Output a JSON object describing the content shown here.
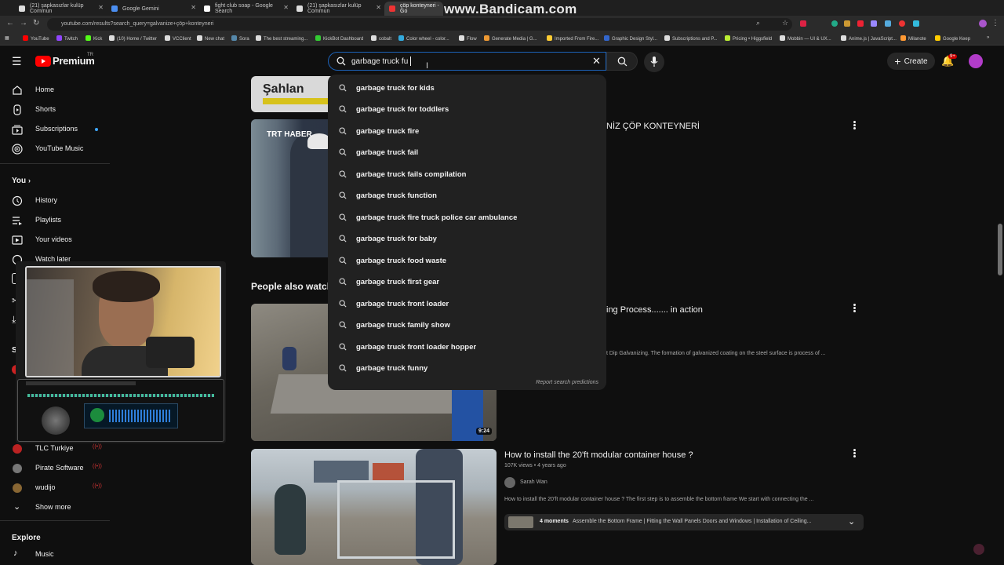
{
  "browser": {
    "tabs": [
      {
        "label": "(21) şapkasızlar kulüp Commun",
        "color": "#cccccc"
      },
      {
        "label": "Google Gemini",
        "color": "#4b8ef0"
      },
      {
        "label": "fight club soap - Google Search",
        "color": "#ffffff"
      },
      {
        "label": "(21) şapkasızlar kulüp Commun",
        "color": "#cccccc"
      },
      {
        "label": "çöp konteyneri - Go",
        "color": "#e33"
      }
    ],
    "watermark": "www.Bandicam.com",
    "url": "youtube.com/results?search_query=galvanize+çöp+konteyneri",
    "bookmarks": [
      "YouTube",
      "Twitch",
      "Kick",
      "(10) Home / Twitter",
      "VCClient",
      "New chat",
      "Sora",
      "The best streaming...",
      "KickBot Dashboard",
      "cobalt",
      "Color wheel - color...",
      "Flow",
      "Generate Media | G...",
      "Imported From Fire...",
      "Graphic Design Styl...",
      "Subscriptions and P...",
      "Pricing • Higgsfield",
      "Mobbin — UI & UX...",
      "Anime.js | JavaScript...",
      "Milanote",
      "Google Keep"
    ]
  },
  "header": {
    "logo": "Premium",
    "logo_region": "TR",
    "search_value": "garbage truck fu",
    "create_label": "Create",
    "notif_badge": "9+"
  },
  "sidebar": {
    "main": [
      {
        "label": "Home",
        "icon": "home-icon"
      },
      {
        "label": "Shorts",
        "icon": "shorts-icon"
      },
      {
        "label": "Subscriptions",
        "icon": "subscriptions-icon"
      },
      {
        "label": "YouTube Music",
        "icon": "music-icon"
      }
    ],
    "you_title": "You",
    "you": [
      {
        "label": "History",
        "icon": "history-icon"
      },
      {
        "label": "Playlists",
        "icon": "playlists-icon"
      },
      {
        "label": "Your videos",
        "icon": "video-icon"
      },
      {
        "label": "Watch later",
        "icon": "clock-icon"
      }
    ],
    "subs": [
      {
        "label": "TLC Turkiye",
        "color": "#b22"
      },
      {
        "label": "Pirate Software",
        "color": "#777"
      },
      {
        "label": "wudijo",
        "color": "#863"
      }
    ],
    "show_more": "Show more",
    "explore_title": "Explore",
    "music": "Music"
  },
  "suggestions": [
    "garbage truck for kids",
    "garbage truck for toddlers",
    "garbage truck fire",
    "garbage truck fail",
    "garbage truck fails compilation",
    "garbage truck function",
    "garbage truck fire truck police car ambulance",
    "garbage truck for baby",
    "garbage truck food waste",
    "garbage truck first gear",
    "garbage truck front loader",
    "garbage truck family show",
    "garbage truck front loader hopper",
    "garbage truck funny"
  ],
  "report_label": "Report search predictions",
  "main": {
    "thumb_top_text": "Şahlan",
    "video1_title_tail": "NİZ ÇÖP KONTEYNERİ",
    "trt_label": "TRT HABER",
    "people_also_watched": "People also watch",
    "video2": {
      "title_tail": "ing Process....... in action",
      "desc_tail": "t Dip Galvanizing. The formation of galvanized coating on the steel surface is process of ...",
      "duration": "9:24"
    },
    "video3": {
      "title": "How to install the 20'ft modular container house ?",
      "views": "107K views",
      "age": "4 years ago",
      "channel": "Sarah Wan",
      "desc": "How to install the 20'ft modular container house ? The first step is to assemble the bottom frame We start with connecting the ...",
      "moments": "4 moments",
      "moments_text": "Assemble the Bottom Frame | Fitting the Wall Panels Doors and Windows | Installation of Ceiling..."
    }
  }
}
